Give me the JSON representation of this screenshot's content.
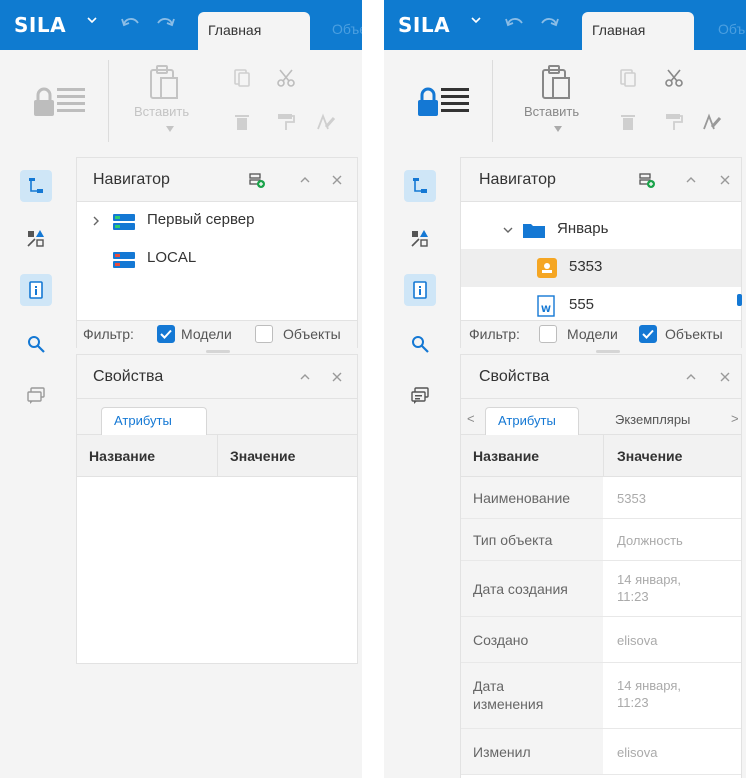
{
  "app": {
    "logo": "SILA",
    "tab_home": "Главная",
    "tab_next": "Объекты"
  },
  "ribbon": {
    "paste_label": "Вставить"
  },
  "left": {
    "nav_title": "Навигатор",
    "tree": [
      {
        "label": "Первый сервер",
        "icon": "server-green-icon"
      },
      {
        "label": "LOCAL",
        "icon": "server-red-icon"
      }
    ],
    "filter_label": "Фильтр:",
    "filter_models": "Модели",
    "filter_objects": "Объекты",
    "filter_models_checked": true,
    "filter_objects_checked": false,
    "props_title": "Свойства",
    "tab_attributes": "Атрибуты",
    "col_name": "Название",
    "col_value": "Значение"
  },
  "right": {
    "nav_title": "Навигатор",
    "tree": [
      {
        "label": "Январь",
        "icon": "folder-icon"
      },
      {
        "label": "5353",
        "icon": "position-icon"
      },
      {
        "label": "555",
        "icon": "word-doc-icon"
      }
    ],
    "filter_label": "Фильтр:",
    "filter_models": "Модели",
    "filter_objects": "Объекты",
    "filter_models_checked": false,
    "filter_objects_checked": true,
    "props_title": "Свойства",
    "tab_attributes": "Атрибуты",
    "tab_instances": "Экземпляры",
    "col_name": "Название",
    "col_value": "Значение",
    "props": [
      {
        "key": "Наименование",
        "value": "5353"
      },
      {
        "key": "Тип объекта",
        "value": "Должность"
      },
      {
        "key": "Дата создания",
        "value": "14 января, 11:23"
      },
      {
        "key": "Создано",
        "value": "elisova"
      },
      {
        "key": "Дата изменения",
        "value": "14 января, 11:23"
      },
      {
        "key": "Изменил",
        "value": "elisova"
      }
    ]
  },
  "colors": {
    "brand": "#0f7bd0",
    "accent": "#1478d4",
    "active_side": "#cfe6f7"
  }
}
